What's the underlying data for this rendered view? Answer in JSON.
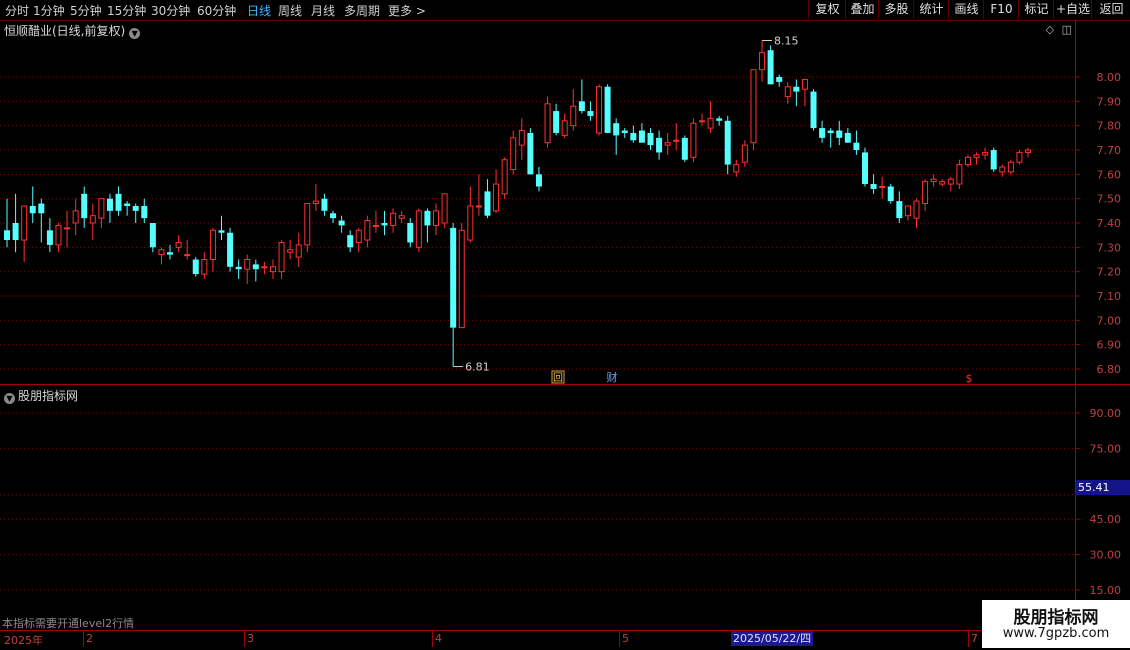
{
  "toolbar": {
    "periods": [
      "分时",
      "1分钟",
      "5分钟",
      "15分钟",
      "30分钟",
      "60分钟",
      "日线",
      "周线",
      "月线",
      "多周期",
      "更多 >"
    ],
    "active_period": "日线",
    "buttons": [
      "复权",
      "叠加",
      "多股",
      "统计",
      "画线",
      "F10",
      "标记",
      "+自选",
      "返回"
    ]
  },
  "stock_title": "恒顺醋业(日线,前复权)",
  "sub_pane_title": "股朋指标网",
  "hint_text": "本指标需要开通level2行情",
  "price_axis": [
    "8.00",
    "7.90",
    "7.80",
    "7.70",
    "7.60",
    "7.50",
    "7.40",
    "7.30",
    "7.20",
    "7.10",
    "7.00",
    "6.90",
    "6.80"
  ],
  "sub_axis": [
    "90.00",
    "75.00",
    "45.00",
    "30.00",
    "15.00"
  ],
  "sub_current_value": "55.41",
  "annotations": {
    "high": "8.15",
    "low": "6.81"
  },
  "markers": {
    "hui": "回",
    "cai": "财",
    "dollar": "$"
  },
  "date_axis": {
    "year": "2025年",
    "months": [
      "2",
      "3",
      "4",
      "5",
      "7"
    ],
    "cursor_date": "2025/05/22/四"
  },
  "watermark": {
    "line1": "股朋指标网",
    "line2": "www.7gpzb.com"
  },
  "colors": {
    "up": "#ff3030",
    "down": "#54ffff",
    "grid": "#7a0000",
    "axis_text": "#c04040"
  },
  "chart_data": {
    "type": "candlestick",
    "ylim": [
      6.76,
      8.26
    ],
    "sub_ylim": [
      12,
      100
    ],
    "candles": [
      {
        "o": 7.37,
        "h": 7.5,
        "l": 7.3,
        "c": 7.33
      },
      {
        "o": 7.4,
        "h": 7.52,
        "l": 7.28,
        "c": 7.33
      },
      {
        "o": 7.33,
        "h": 7.45,
        "l": 7.24,
        "c": 7.47
      },
      {
        "o": 7.47,
        "h": 7.55,
        "l": 7.4,
        "c": 7.44
      },
      {
        "o": 7.48,
        "h": 7.5,
        "l": 7.32,
        "c": 7.44
      },
      {
        "o": 7.37,
        "h": 7.42,
        "l": 7.28,
        "c": 7.31
      },
      {
        "o": 7.31,
        "h": 7.4,
        "l": 7.28,
        "c": 7.39
      },
      {
        "o": 7.38,
        "h": 7.45,
        "l": 7.3,
        "c": 7.38
      },
      {
        "o": 7.4,
        "h": 7.5,
        "l": 7.35,
        "c": 7.45
      },
      {
        "o": 7.52,
        "h": 7.55,
        "l": 7.38,
        "c": 7.42
      },
      {
        "o": 7.4,
        "h": 7.48,
        "l": 7.33,
        "c": 7.43
      },
      {
        "o": 7.42,
        "h": 7.5,
        "l": 7.38,
        "c": 7.5
      },
      {
        "o": 7.5,
        "h": 7.52,
        "l": 7.4,
        "c": 7.45
      },
      {
        "o": 7.52,
        "h": 7.55,
        "l": 7.43,
        "c": 7.45
      },
      {
        "o": 7.48,
        "h": 7.49,
        "l": 7.43,
        "c": 7.47
      },
      {
        "o": 7.47,
        "h": 7.48,
        "l": 7.4,
        "c": 7.45
      },
      {
        "o": 7.47,
        "h": 7.5,
        "l": 7.4,
        "c": 7.42
      },
      {
        "o": 7.4,
        "h": 7.4,
        "l": 7.28,
        "c": 7.3
      },
      {
        "o": 7.27,
        "h": 7.3,
        "l": 7.23,
        "c": 7.29
      },
      {
        "o": 7.28,
        "h": 7.31,
        "l": 7.25,
        "c": 7.27
      },
      {
        "o": 7.3,
        "h": 7.35,
        "l": 7.28,
        "c": 7.32
      },
      {
        "o": 7.27,
        "h": 7.33,
        "l": 7.25,
        "c": 7.27
      },
      {
        "o": 7.25,
        "h": 7.26,
        "l": 7.18,
        "c": 7.19
      },
      {
        "o": 7.19,
        "h": 7.28,
        "l": 7.17,
        "c": 7.25
      },
      {
        "o": 7.25,
        "h": 7.38,
        "l": 7.2,
        "c": 7.37
      },
      {
        "o": 7.37,
        "h": 7.43,
        "l": 7.33,
        "c": 7.36
      },
      {
        "o": 7.36,
        "h": 7.38,
        "l": 7.2,
        "c": 7.22
      },
      {
        "o": 7.22,
        "h": 7.25,
        "l": 7.17,
        "c": 7.21
      },
      {
        "o": 7.21,
        "h": 7.27,
        "l": 7.15,
        "c": 7.25
      },
      {
        "o": 7.23,
        "h": 7.25,
        "l": 7.16,
        "c": 7.21
      },
      {
        "o": 7.22,
        "h": 7.24,
        "l": 7.19,
        "c": 7.22
      },
      {
        "o": 7.2,
        "h": 7.25,
        "l": 7.17,
        "c": 7.22
      },
      {
        "o": 7.2,
        "h": 7.33,
        "l": 7.17,
        "c": 7.32
      },
      {
        "o": 7.28,
        "h": 7.33,
        "l": 7.25,
        "c": 7.29
      },
      {
        "o": 7.26,
        "h": 7.36,
        "l": 7.22,
        "c": 7.31
      },
      {
        "o": 7.31,
        "h": 7.48,
        "l": 7.28,
        "c": 7.48
      },
      {
        "o": 7.48,
        "h": 7.56,
        "l": 7.45,
        "c": 7.49
      },
      {
        "o": 7.5,
        "h": 7.52,
        "l": 7.43,
        "c": 7.45
      },
      {
        "o": 7.44,
        "h": 7.45,
        "l": 7.4,
        "c": 7.42
      },
      {
        "o": 7.41,
        "h": 7.43,
        "l": 7.36,
        "c": 7.39
      },
      {
        "o": 7.35,
        "h": 7.37,
        "l": 7.28,
        "c": 7.3
      },
      {
        "o": 7.32,
        "h": 7.38,
        "l": 7.28,
        "c": 7.37
      },
      {
        "o": 7.33,
        "h": 7.43,
        "l": 7.3,
        "c": 7.41
      },
      {
        "o": 7.39,
        "h": 7.45,
        "l": 7.36,
        "c": 7.39
      },
      {
        "o": 7.4,
        "h": 7.45,
        "l": 7.35,
        "c": 7.39
      },
      {
        "o": 7.39,
        "h": 7.46,
        "l": 7.36,
        "c": 7.44
      },
      {
        "o": 7.42,
        "h": 7.45,
        "l": 7.4,
        "c": 7.43
      },
      {
        "o": 7.4,
        "h": 7.42,
        "l": 7.3,
        "c": 7.32
      },
      {
        "o": 7.3,
        "h": 7.46,
        "l": 7.28,
        "c": 7.45
      },
      {
        "o": 7.45,
        "h": 7.46,
        "l": 7.32,
        "c": 7.39
      },
      {
        "o": 7.39,
        "h": 7.48,
        "l": 7.35,
        "c": 7.45
      },
      {
        "o": 7.4,
        "h": 7.52,
        "l": 7.38,
        "c": 7.52
      },
      {
        "o": 7.38,
        "h": 7.4,
        "l": 6.81,
        "c": 6.97
      },
      {
        "o": 6.97,
        "h": 7.4,
        "l": 6.97,
        "c": 7.37
      },
      {
        "o": 7.33,
        "h": 7.55,
        "l": 7.32,
        "c": 7.47
      },
      {
        "o": 7.47,
        "h": 7.6,
        "l": 7.43,
        "c": 7.47
      },
      {
        "o": 7.53,
        "h": 7.58,
        "l": 7.42,
        "c": 7.43
      },
      {
        "o": 7.45,
        "h": 7.62,
        "l": 7.44,
        "c": 7.56
      },
      {
        "o": 7.52,
        "h": 7.67,
        "l": 7.5,
        "c": 7.66
      },
      {
        "o": 7.62,
        "h": 7.78,
        "l": 7.6,
        "c": 7.75
      },
      {
        "o": 7.72,
        "h": 7.83,
        "l": 7.66,
        "c": 7.78
      },
      {
        "o": 7.77,
        "h": 7.79,
        "l": 7.6,
        "c": 7.6
      },
      {
        "o": 7.6,
        "h": 7.63,
        "l": 7.53,
        "c": 7.55
      },
      {
        "o": 7.73,
        "h": 7.92,
        "l": 7.71,
        "c": 7.89
      },
      {
        "o": 7.86,
        "h": 7.89,
        "l": 7.76,
        "c": 7.77
      },
      {
        "o": 7.76,
        "h": 7.85,
        "l": 7.75,
        "c": 7.82
      },
      {
        "o": 7.8,
        "h": 7.95,
        "l": 7.78,
        "c": 7.88
      },
      {
        "o": 7.9,
        "h": 7.99,
        "l": 7.85,
        "c": 7.86
      },
      {
        "o": 7.86,
        "h": 7.9,
        "l": 7.82,
        "c": 7.84
      },
      {
        "o": 7.77,
        "h": 7.97,
        "l": 7.76,
        "c": 7.96
      },
      {
        "o": 7.96,
        "h": 7.97,
        "l": 7.77,
        "c": 7.77
      },
      {
        "o": 7.81,
        "h": 7.83,
        "l": 7.68,
        "c": 7.76
      },
      {
        "o": 7.78,
        "h": 7.79,
        "l": 7.75,
        "c": 7.77
      },
      {
        "o": 7.77,
        "h": 7.8,
        "l": 7.73,
        "c": 7.74
      },
      {
        "o": 7.78,
        "h": 7.81,
        "l": 7.74,
        "c": 7.73
      },
      {
        "o": 7.77,
        "h": 7.79,
        "l": 7.7,
        "c": 7.72
      },
      {
        "o": 7.75,
        "h": 7.78,
        "l": 7.66,
        "c": 7.69
      },
      {
        "o": 7.72,
        "h": 7.77,
        "l": 7.68,
        "c": 7.73
      },
      {
        "o": 7.74,
        "h": 7.81,
        "l": 7.7,
        "c": 7.74
      },
      {
        "o": 7.75,
        "h": 7.76,
        "l": 7.65,
        "c": 7.66
      },
      {
        "o": 7.67,
        "h": 7.83,
        "l": 7.65,
        "c": 7.81
      },
      {
        "o": 7.82,
        "h": 7.85,
        "l": 7.8,
        "c": 7.82
      },
      {
        "o": 7.79,
        "h": 7.9,
        "l": 7.77,
        "c": 7.83
      },
      {
        "o": 7.83,
        "h": 7.84,
        "l": 7.8,
        "c": 7.82
      },
      {
        "o": 7.82,
        "h": 7.84,
        "l": 7.6,
        "c": 7.64
      },
      {
        "o": 7.61,
        "h": 7.66,
        "l": 7.59,
        "c": 7.64
      },
      {
        "o": 7.65,
        "h": 7.74,
        "l": 7.63,
        "c": 7.72
      },
      {
        "o": 7.73,
        "h": 8.03,
        "l": 7.7,
        "c": 8.03
      },
      {
        "o": 8.03,
        "h": 8.15,
        "l": 7.98,
        "c": 8.1
      },
      {
        "o": 8.11,
        "h": 8.13,
        "l": 7.97,
        "c": 7.97
      },
      {
        "o": 8.0,
        "h": 8.01,
        "l": 7.96,
        "c": 7.98
      },
      {
        "o": 7.92,
        "h": 7.98,
        "l": 7.89,
        "c": 7.96
      },
      {
        "o": 7.96,
        "h": 7.99,
        "l": 7.88,
        "c": 7.94
      },
      {
        "o": 7.95,
        "h": 7.99,
        "l": 7.88,
        "c": 7.99
      },
      {
        "o": 7.94,
        "h": 7.95,
        "l": 7.78,
        "c": 7.79
      },
      {
        "o": 7.79,
        "h": 7.82,
        "l": 7.73,
        "c": 7.75
      },
      {
        "o": 7.78,
        "h": 7.79,
        "l": 7.71,
        "c": 7.77
      },
      {
        "o": 7.78,
        "h": 7.82,
        "l": 7.72,
        "c": 7.75
      },
      {
        "o": 7.77,
        "h": 7.79,
        "l": 7.73,
        "c": 7.73
      },
      {
        "o": 7.73,
        "h": 7.78,
        "l": 7.68,
        "c": 7.7
      },
      {
        "o": 7.69,
        "h": 7.71,
        "l": 7.55,
        "c": 7.56
      },
      {
        "o": 7.56,
        "h": 7.6,
        "l": 7.52,
        "c": 7.54
      },
      {
        "o": 7.55,
        "h": 7.59,
        "l": 7.5,
        "c": 7.55
      },
      {
        "o": 7.55,
        "h": 7.56,
        "l": 7.48,
        "c": 7.49
      },
      {
        "o": 7.49,
        "h": 7.53,
        "l": 7.4,
        "c": 7.42
      },
      {
        "o": 7.43,
        "h": 7.47,
        "l": 7.41,
        "c": 7.47
      },
      {
        "o": 7.42,
        "h": 7.5,
        "l": 7.38,
        "c": 7.49
      },
      {
        "o": 7.48,
        "h": 7.58,
        "l": 7.45,
        "c": 7.57
      },
      {
        "o": 7.57,
        "h": 7.6,
        "l": 7.55,
        "c": 7.58
      },
      {
        "o": 7.56,
        "h": 7.58,
        "l": 7.55,
        "c": 7.57
      },
      {
        "o": 7.56,
        "h": 7.59,
        "l": 7.53,
        "c": 7.58
      },
      {
        "o": 7.56,
        "h": 7.66,
        "l": 7.54,
        "c": 7.64
      },
      {
        "o": 7.64,
        "h": 7.68,
        "l": 7.63,
        "c": 7.67
      },
      {
        "o": 7.67,
        "h": 7.69,
        "l": 7.64,
        "c": 7.68
      },
      {
        "o": 7.68,
        "h": 7.71,
        "l": 7.66,
        "c": 7.69
      },
      {
        "o": 7.7,
        "h": 7.71,
        "l": 7.61,
        "c": 7.62
      },
      {
        "o": 7.61,
        "h": 7.64,
        "l": 7.59,
        "c": 7.63
      },
      {
        "o": 7.61,
        "h": 7.66,
        "l": 7.6,
        "c": 7.65
      },
      {
        "o": 7.65,
        "h": 7.7,
        "l": 7.64,
        "c": 7.69
      },
      {
        "o": 7.69,
        "h": 7.71,
        "l": 7.67,
        "c": 7.7
      }
    ]
  }
}
